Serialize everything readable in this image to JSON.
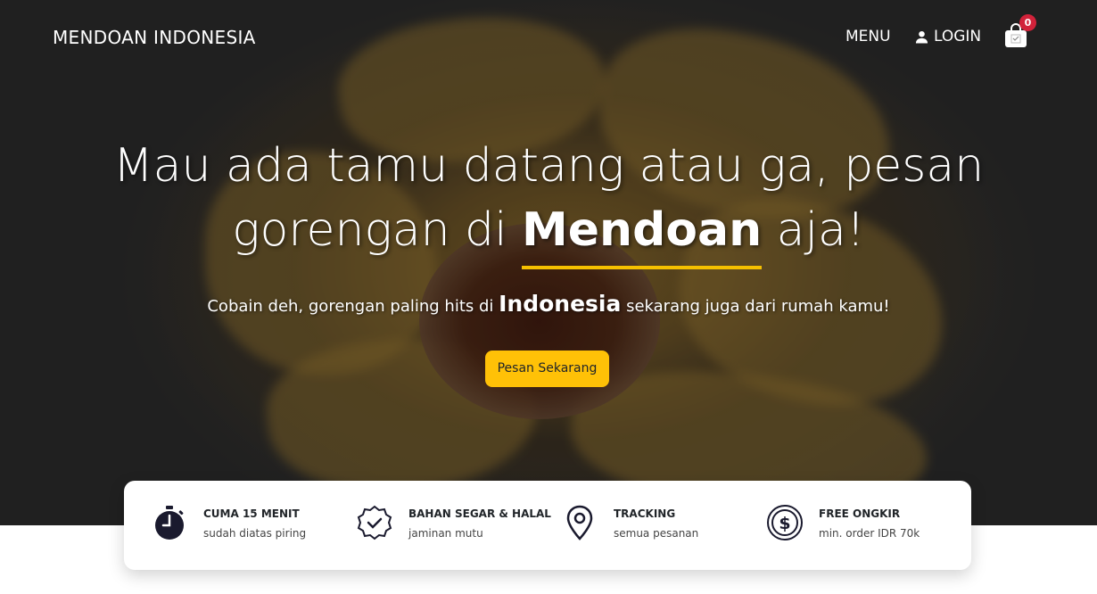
{
  "nav": {
    "brand": "MENDOAN INDONESIA",
    "menu_label": "MENU",
    "login_label": "LOGIN",
    "cart_count": "0"
  },
  "hero": {
    "headline_line1": "Mau ada tamu datang atau ga, pesan",
    "headline_line2_pre": "gorengan di ",
    "headline_line2_strong": "Mendoan",
    "headline_line2_post": " aja!",
    "sub_pre": "Cobain deh, gorengan paling hits di ",
    "sub_strong": "Indonesia",
    "sub_post": " sekarang juga dari rumah kamu!",
    "cta_label": "Pesan Sekarang"
  },
  "features": [
    {
      "icon": "stopwatch-icon",
      "title": "CUMA 15 MENIT",
      "desc": "sudah diatas piring"
    },
    {
      "icon": "verified-badge-icon",
      "title": "BAHAN SEGAR & HALAL",
      "desc": "jaminan mutu"
    },
    {
      "icon": "map-pin-icon",
      "title": "TRACKING",
      "desc": "semua pesanan"
    },
    {
      "icon": "dollar-coin-icon",
      "title": "FREE ONGKIR",
      "desc": "min. order IDR 70k"
    }
  ],
  "colors": {
    "accent": "#ffc107",
    "underline": "#f5c000",
    "badge": "#d1223a"
  }
}
